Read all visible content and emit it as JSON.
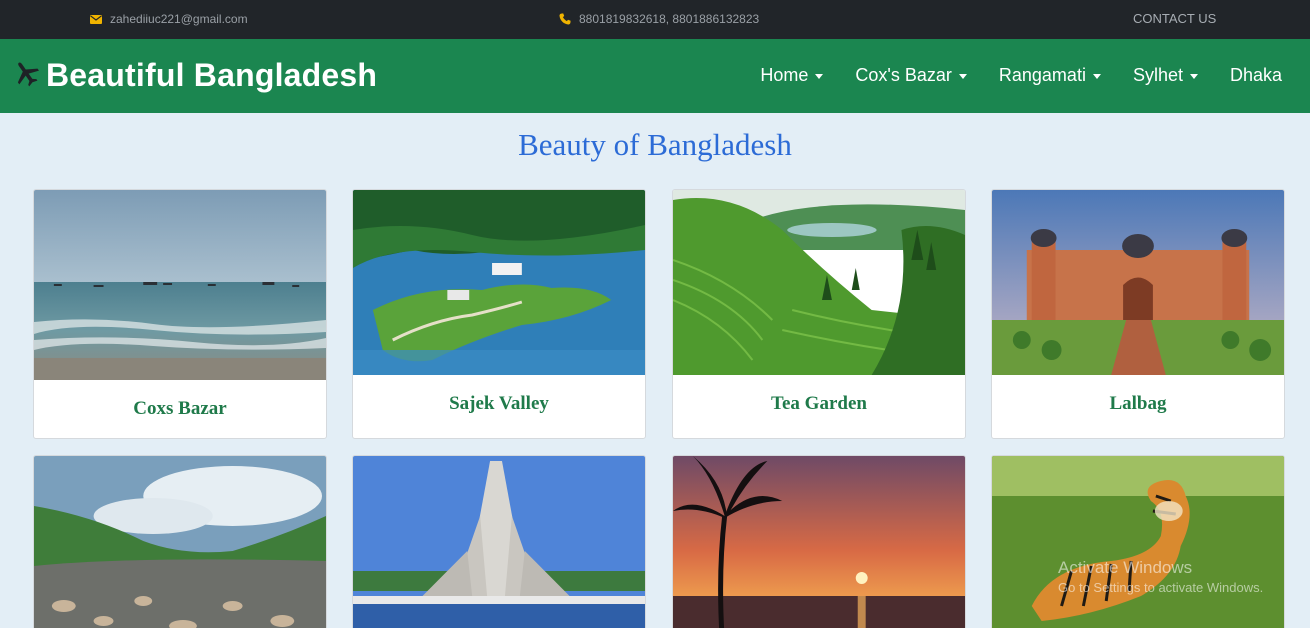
{
  "topbar": {
    "email": "zahediiuc221@gmail.com",
    "phone": "8801819832618, 8801886132823",
    "contact": "CONTACT US"
  },
  "navbar": {
    "brand": "Beautiful Bangladesh",
    "items": [
      {
        "label": "Home",
        "dropdown": true
      },
      {
        "label": "Cox's Bazar",
        "dropdown": true
      },
      {
        "label": "Rangamati",
        "dropdown": true
      },
      {
        "label": "Sylhet",
        "dropdown": true
      },
      {
        "label": "Dhaka",
        "dropdown": false
      }
    ]
  },
  "main": {
    "title": "Beauty of Bangladesh",
    "cards": [
      {
        "caption": "Coxs Bazar",
        "image": "beach-photo"
      },
      {
        "caption": "Sajek Valley",
        "image": "lake-island-photo"
      },
      {
        "caption": "Tea Garden",
        "image": "tea-hills-photo"
      },
      {
        "caption": "Lalbag",
        "image": "fort-photo"
      },
      {
        "caption": "",
        "image": "river-rocks-photo"
      },
      {
        "caption": "",
        "image": "monument-photo"
      },
      {
        "caption": "",
        "image": "sunset-palm-photo"
      },
      {
        "caption": "",
        "image": "tiger-photo"
      }
    ]
  },
  "watermark": {
    "line1": "Activate Windows",
    "line2": "Go to Settings to activate Windows."
  },
  "colors": {
    "topbar": "#212529",
    "navbar": "#1b8650",
    "title": "#2c6bd6",
    "caption": "#1f7a4a",
    "background": "#e3eef6"
  }
}
